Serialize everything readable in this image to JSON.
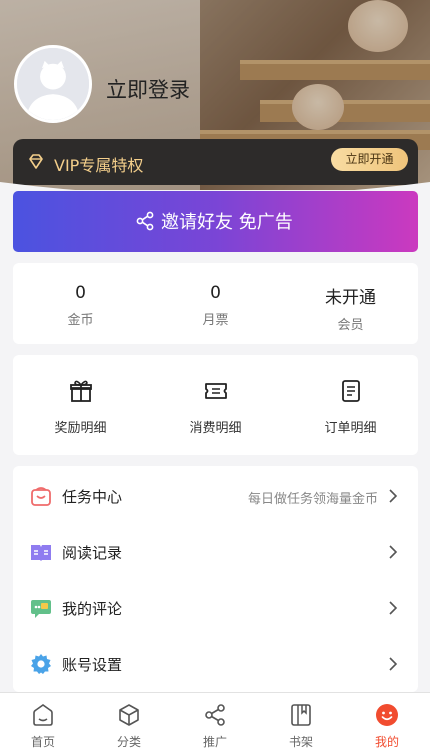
{
  "header": {
    "login_label": "立即登录",
    "vip_label": "VIP专属特权",
    "vip_button": "立即开通"
  },
  "invite": {
    "label": "邀请好友 免广告"
  },
  "stats": [
    {
      "value": "0",
      "label": "金币"
    },
    {
      "value": "0",
      "label": "月票"
    },
    {
      "value": "未开通",
      "label": "会员"
    }
  ],
  "records": [
    {
      "label": "奖励明细",
      "icon": "gift-icon"
    },
    {
      "label": "消费明细",
      "icon": "ticket-icon"
    },
    {
      "label": "订单明细",
      "icon": "order-list-icon"
    }
  ],
  "menu": [
    {
      "label": "任务中心",
      "hint": "每日做任务领海量金币",
      "icon": "task-bag-icon"
    },
    {
      "label": "阅读记录",
      "hint": "",
      "icon": "reading-book-icon"
    },
    {
      "label": "我的评论",
      "hint": "",
      "icon": "comment-icon"
    },
    {
      "label": "账号设置",
      "hint": "",
      "icon": "settings-gear-icon"
    }
  ],
  "tabs": [
    {
      "label": "首页",
      "icon": "home-icon"
    },
    {
      "label": "分类",
      "icon": "category-cube-icon"
    },
    {
      "label": "推广",
      "icon": "share-icon"
    },
    {
      "label": "书架",
      "icon": "bookshelf-icon"
    },
    {
      "label": "我的",
      "icon": "profile-smile-icon",
      "active": true
    }
  ],
  "colors": {
    "accent": "#f14c2f",
    "vip_gold": "#f4cf8b",
    "invite_gradient_start": "#4b53e0",
    "invite_gradient_end": "#cb39bf"
  }
}
